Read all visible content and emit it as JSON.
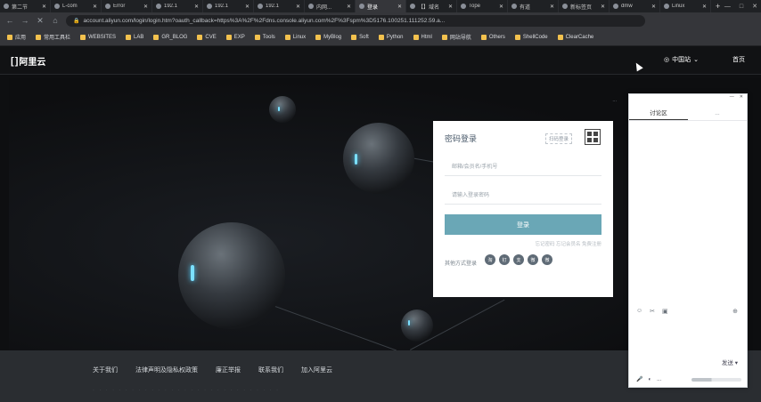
{
  "browser": {
    "tabs": [
      {
        "label": "第二节",
        "active": false
      },
      {
        "label": "L-com",
        "active": false
      },
      {
        "label": "Error",
        "active": false
      },
      {
        "label": "192.1",
        "active": false
      },
      {
        "label": "192.1",
        "active": false
      },
      {
        "label": "192.1",
        "active": false
      },
      {
        "label": "内网...",
        "active": false
      },
      {
        "label": "登录",
        "active": true
      },
      {
        "label": "【】域名",
        "active": false
      },
      {
        "label": "Tope",
        "active": false
      },
      {
        "label": "有道",
        "active": false
      },
      {
        "label": "新标签页",
        "active": false
      },
      {
        "label": "dmw",
        "active": false
      },
      {
        "label": "Linux",
        "active": false
      }
    ],
    "new_tab": "+",
    "window_controls": [
      "—",
      "□",
      "✕"
    ],
    "url": "account.aliyun.com/login/login.htm?oauth_callback=https%3A%2F%2Fdns.console.aliyun.com%2F%3Fspm%3D5176.100251.111252.59.a...",
    "bookmarks": [
      "应用",
      "常用工具栏",
      "WEBSITES",
      "LAB",
      "GR_BLOG",
      "CVE",
      "EXP",
      "Tools",
      "Linux",
      "MyBlog",
      "Soft",
      "Python",
      "Html",
      "网站导航",
      "Others",
      "ShellCode",
      "ClearCache"
    ]
  },
  "header": {
    "logo_text": "阿里云",
    "lang": "中国站",
    "home": "首页"
  },
  "hero": {
    "tag": "..."
  },
  "login": {
    "title": "密码登录",
    "qr_hint": "扫码登录",
    "username_placeholder": "邮箱/会员名/手机号",
    "password_placeholder": "请输入登录密码",
    "submit": "登录",
    "links": "忘记密码  忘记会员名  免费注册",
    "other_label": "其他方式登录",
    "other_icons": [
      "淘",
      "钉",
      "支",
      "微",
      "微"
    ]
  },
  "footer": {
    "links": [
      "关于我们",
      "法律声明及隐私权政策",
      "廉正举报",
      "联系我们",
      "加入阿里云"
    ],
    "sub": "· · · · · · · · · · · · · · · · · · · · · · · · · · · · ·"
  },
  "panel": {
    "tabs": [
      "讨论区",
      "..."
    ],
    "send": "发送 ▾",
    "bottom": "..."
  }
}
